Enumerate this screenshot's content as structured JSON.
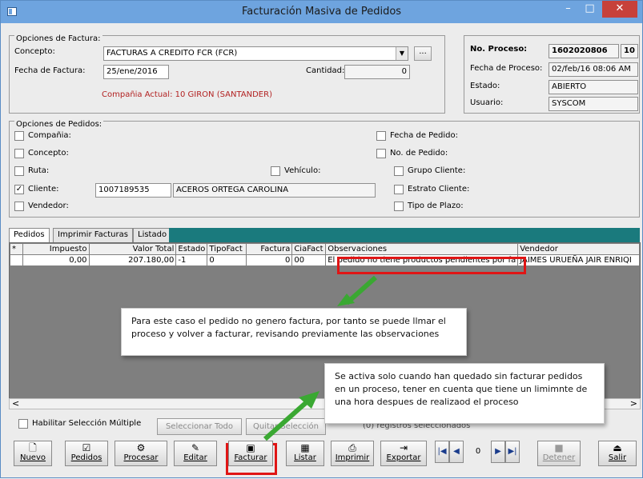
{
  "window": {
    "title": "Facturación Masiva de Pedidos",
    "min": "–",
    "max": "□",
    "close": "✕"
  },
  "invoice_options": {
    "legend": "Opciones de Factura:",
    "concepto_label": "Concepto:",
    "concepto_value": "FACTURAS A CREDITO FCR  (FCR)",
    "ellipsis": "...",
    "fecha_label": "Fecha de Factura:",
    "fecha_value": "25/ene/2016",
    "cantidad_label": "Cantidad:",
    "cantidad_value": "0",
    "company": "Compañia Actual: 10 GIRON  (SANTANDER)"
  },
  "process": {
    "no_label": "No. Proceso:",
    "no_value": "1602020806",
    "no_value2": "10",
    "fecha_label": "Fecha de Proceso:",
    "fecha_value": "02/feb/16 08:06 AM",
    "estado_label": "Estado:",
    "estado_value": "ABIERTO",
    "usuario_label": "Usuario:",
    "usuario_value": "SYSCOM"
  },
  "order_options": {
    "legend": "Opciones de Pedidos:",
    "compania": "Compañia:",
    "concepto": "Concepto:",
    "ruta": "Ruta:",
    "cliente": "Cliente:",
    "cliente_code": "1007189535",
    "cliente_name": "ACEROS ORTEGA CAROLINA",
    "vendedor": "Vendedor:",
    "vehiculo": "Vehículo:",
    "fecha_pedido": "Fecha de Pedido:",
    "no_pedido": "No. de Pedido:",
    "grupo_cliente": "Grupo Cliente:",
    "estrato_cliente": "Estrato Cliente:",
    "tipo_plazo": "Tipo de Plazo:"
  },
  "tabs": [
    "Pedidos",
    "Imprimir Facturas",
    "Listado"
  ],
  "grid": {
    "headers": [
      "*",
      "Impuesto",
      "Valor Total",
      "Estado",
      "TipoFact",
      "Factura",
      "CiaFact",
      "Observaciones",
      "Vendedor"
    ],
    "row": [
      "",
      "0,00",
      "207.180,00",
      "-1",
      "0",
      "0",
      "00",
      "El pedido no tiene productos pendientes por fa",
      "JAIMES URUEÑA JAIR ENRIQI"
    ]
  },
  "scroll": {
    "left": "<",
    "right": ">"
  },
  "callouts": {
    "one": "Para este caso el pedido no genero factura, por tanto se puede llmar el proceso y volver a facturar, revisando previamente las observaciones",
    "two": "Se activa solo cuando han quedado sin facturar pedidos en un proceso, tener en cuenta que tiene un limimnte de una hora despues de realizaod el proceso"
  },
  "selection": {
    "habilitar": "Habilitar Selección Múltiple",
    "seleccionar_todo": "Seleccionar Todo",
    "quitar": "Quitar Selección",
    "registros": "(0) registros seleccionados"
  },
  "toolbar": {
    "nuevo": "Nuevo",
    "pedidos": "Pedidos",
    "procesar": "Procesar",
    "editar": "Editar",
    "facturar": "Facturar",
    "listar": "Listar",
    "imprimir": "Imprimir",
    "exportar": "Exportar",
    "page": "0",
    "detener": "Detener",
    "salir": "Salir"
  },
  "colors": {
    "title_bar": "#6ea4df",
    "close": "#c7413a",
    "highlight": "#e01515",
    "arrow": "#3aa832",
    "tab_bar": "#1a7a7d"
  }
}
